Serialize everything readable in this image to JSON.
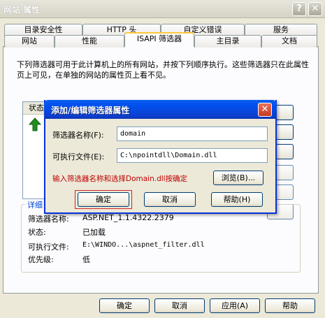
{
  "window": {
    "title": "网站 属性",
    "help_glyph": "?",
    "close_glyph": "✕"
  },
  "tabs_row1": [
    "目录安全性",
    "HTTP 头",
    "自定义错误",
    "服务"
  ],
  "tabs_row2": [
    "网站",
    "性能",
    "ISAPI 筛选器",
    "主目录",
    "文档"
  ],
  "active_tab": "ISAPI 筛选器",
  "description": "下列筛选器可用于此计算机上的所有网站，并按下列顺序执行。这些筛选器只在此属性页上可见，在单独的网站的属性页上看不见。",
  "list": {
    "header_status": "状态"
  },
  "details": {
    "legend": "详细",
    "rows": [
      {
        "label": "筛选器名称:",
        "value": "ASP.NET_1.1.4322.2379"
      },
      {
        "label": "状态:",
        "value": "已加载"
      },
      {
        "label": "可执行文件:",
        "value": "E:\\WINDO...\\aspnet_filter.dll"
      },
      {
        "label": "优先级:",
        "value": "低"
      }
    ]
  },
  "bottom_buttons": {
    "ok": "确定",
    "cancel": "取消",
    "apply": "应用(A)",
    "help": "帮助"
  },
  "dialog": {
    "title": "添加/编辑筛选器属性",
    "name_label": "筛选器名称(F):",
    "name_value": "domain",
    "exe_label": "可执行文件(E):",
    "exe_value": "C:\\npointdll\\Domain.dll",
    "hint": "输入筛选器名称和选择Domain.dll按确定",
    "browse": "浏览(B)...",
    "ok": "确定",
    "cancel": "取消",
    "help": "帮助(H)"
  },
  "colors": {
    "dialog_title": "#0a5ef0",
    "hint_text": "#c00000",
    "tab_highlight": "#ffc83c"
  }
}
